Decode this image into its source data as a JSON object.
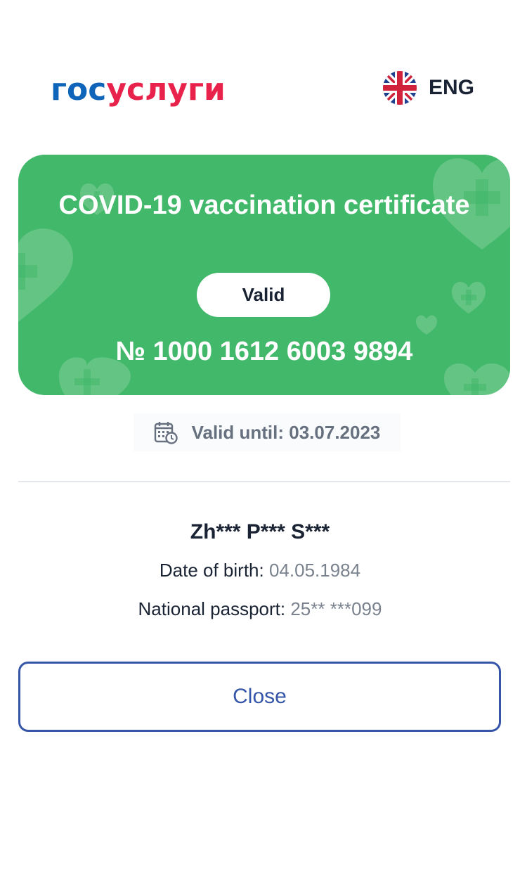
{
  "header": {
    "logo_part1": "гос",
    "logo_part2": "услуги",
    "language_label": "ENG",
    "language_icon": "uk-flag-icon"
  },
  "certificate": {
    "title": "COVID-19 vaccination certificate",
    "status": "Valid",
    "number": "№ 1000 1612 6003 9894",
    "card_color": "#42b86a"
  },
  "validity": {
    "icon": "calendar-clock-icon",
    "text": "Valid until: 03.07.2023"
  },
  "person": {
    "name": "Zh*** P*** S***",
    "dob_label": "Date of birth:",
    "dob_value": "04.05.1984",
    "passport_label": "National passport:",
    "passport_value": "25** ***099"
  },
  "actions": {
    "close_label": "Close"
  },
  "colors": {
    "brand_blue": "#0d64b8",
    "brand_red": "#e8224a",
    "button_blue": "#3556a8"
  }
}
